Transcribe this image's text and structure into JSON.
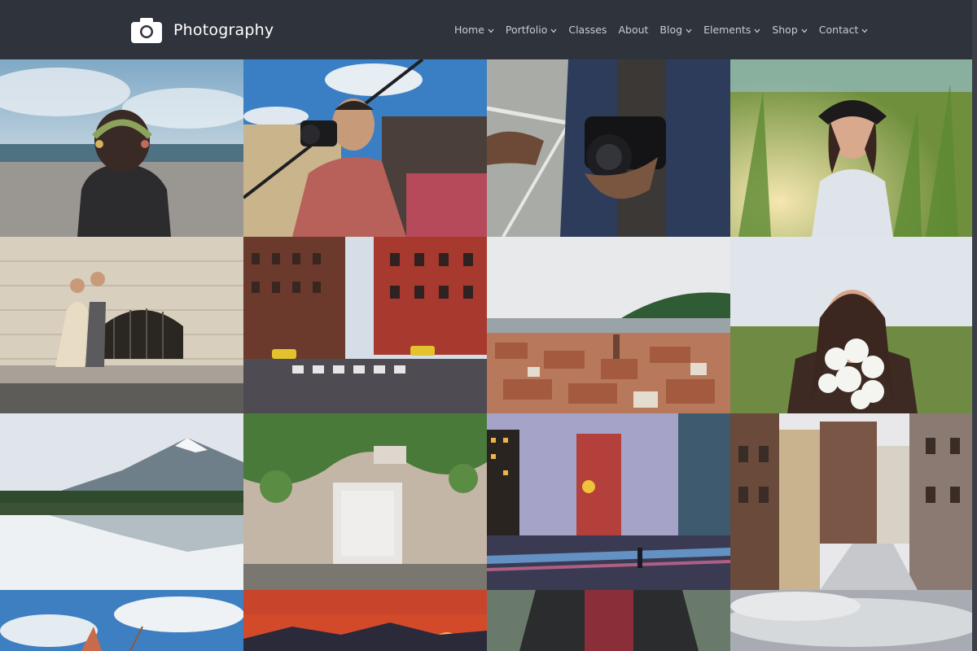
{
  "site": {
    "title": "Photography"
  },
  "nav": {
    "items": [
      {
        "label": "Home",
        "dropdown": true
      },
      {
        "label": "Portfolio",
        "dropdown": true
      },
      {
        "label": "Classes",
        "dropdown": false
      },
      {
        "label": "About",
        "dropdown": false
      },
      {
        "label": "Blog",
        "dropdown": true
      },
      {
        "label": "Elements",
        "dropdown": true
      },
      {
        "label": "Shop",
        "dropdown": true
      },
      {
        "label": "Contact",
        "dropdown": true
      }
    ]
  },
  "theme": {
    "header_bg": "#2f333b",
    "nav_text": "#c9ccd1",
    "logo_text": "#ffffff"
  },
  "gallery": {
    "photos": [
      {
        "subject": "woman-flower-crown-beach"
      },
      {
        "subject": "photographer-with-camera"
      },
      {
        "subject": "hands-holding-canon-camera"
      },
      {
        "subject": "woman-in-cornfield"
      },
      {
        "subject": "couple-walking-stone-wall"
      },
      {
        "subject": "city-street-crosswalk"
      },
      {
        "subject": "old-town-rooftops"
      },
      {
        "subject": "woman-with-white-flowers"
      },
      {
        "subject": "mountain-lake-reflection"
      },
      {
        "subject": "ivy-covered-wall"
      },
      {
        "subject": "city-night-lights"
      },
      {
        "subject": "european-street-buildings"
      },
      {
        "subject": "sailboat-sky"
      },
      {
        "subject": "sunset-mountains"
      },
      {
        "subject": "person-red-sweater"
      },
      {
        "subject": "cloudy-sky"
      }
    ]
  }
}
